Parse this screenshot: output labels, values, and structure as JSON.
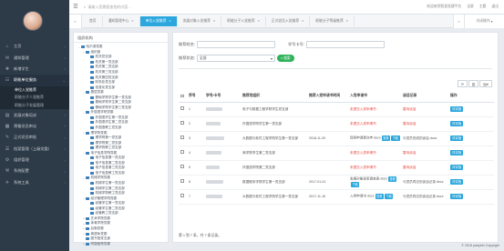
{
  "sidebar": {
    "user": {
      "name": "",
      "role": ""
    },
    "items": [
      {
        "label": "主页",
        "icon": "⌂",
        "arrow": "›"
      },
      {
        "label": "通知管理",
        "icon": "✉",
        "arrow": "›"
      },
      {
        "label": "新增学生",
        "icon": "✚",
        "arrow": "›"
      }
    ],
    "open_item": {
      "label": "职能单位服务",
      "icon": "☷",
      "arrow": "⌄"
    },
    "sub_items": [
      "单位入党推荐",
      "职能分子人党推荐",
      "职能分子发展管理"
    ],
    "more_items": [
      {
        "label": "发展对象培训",
        "icon": "▤",
        "arrow": "›"
      },
      {
        "label": "预备党员审议",
        "icon": "▦",
        "arrow": "›"
      },
      {
        "label": "正式党员审批",
        "icon": "✎",
        "arrow": "›"
      },
      {
        "label": "档案管理（上级党委）",
        "icon": "☰",
        "arrow": "›"
      },
      {
        "label": "组织管理",
        "icon": "⚙",
        "arrow": "›"
      },
      {
        "label": "系统配置",
        "icon": "⚒",
        "arrow": "›"
      },
      {
        "label": "系统工具",
        "icon": "✈",
        "arrow": "›"
      }
    ]
  },
  "topbar": {
    "search_placeholder": "请输入您需要查找的内容...",
    "links": [
      "欢迎来到智慧党建平台",
      "全屏",
      "主题",
      "退出"
    ],
    "menu_icon": "☰"
  },
  "tabs": {
    "items": [
      "首页",
      "通知管理中心",
      "单位入党推荐",
      "发展对象入党推荐",
      "职能分子入党推荐",
      "正式党员入党推荐",
      "职能分子等级推荐"
    ],
    "active_index": 2,
    "close_label": "关闭操作",
    "left_arrow": "«",
    "right_arrow": "»"
  },
  "left_panel": {
    "title": "组织机构",
    "tree": [
      {
        "label": "哈尔滨党委",
        "level": 0,
        "toggle": "−"
      },
      {
        "label": "组织部",
        "level": 1,
        "toggle": "−"
      },
      {
        "label": "机关党支部",
        "level": 2,
        "toggle": ""
      },
      {
        "label": "机关第一党支部",
        "level": 2,
        "toggle": ""
      },
      {
        "label": "机关第二党支部",
        "level": 2,
        "toggle": ""
      },
      {
        "label": "机关第三党支部",
        "level": 2,
        "toggle": ""
      },
      {
        "label": "机关第四党支部",
        "level": 2,
        "toggle": ""
      },
      {
        "label": "财务处党支部",
        "level": 2,
        "toggle": ""
      },
      {
        "label": "信息化党支部",
        "level": 2,
        "toggle": ""
      },
      {
        "label": "基层党委",
        "level": 1,
        "toggle": "−"
      },
      {
        "label": "基础学院学生第一党支部",
        "level": 2,
        "toggle": ""
      },
      {
        "label": "基础学院学生第二党支部",
        "level": 2,
        "toggle": ""
      },
      {
        "label": "基础学院学生第三党支部",
        "level": 2,
        "toggle": ""
      },
      {
        "label": "外国语学院党委",
        "level": 1,
        "toggle": "−"
      },
      {
        "label": "外国语学生第一党支部",
        "level": 2,
        "toggle": ""
      },
      {
        "label": "外国语学生第二党支部",
        "level": 2,
        "toggle": ""
      },
      {
        "label": "外国语教工党支部",
        "level": 2,
        "toggle": ""
      },
      {
        "label": "理学院党委",
        "level": 1,
        "toggle": "−"
      },
      {
        "label": "理学院第一党支部",
        "level": 2,
        "toggle": ""
      },
      {
        "label": "理学院第二党支部",
        "level": 2,
        "toggle": ""
      },
      {
        "label": "理学院教工党支部",
        "level": 2,
        "toggle": ""
      },
      {
        "label": "电子信息学院党委",
        "level": 1,
        "toggle": "−"
      },
      {
        "label": "电子信息第一党支部",
        "level": 2,
        "toggle": ""
      },
      {
        "label": "电子信息第二党支部",
        "level": 2,
        "toggle": ""
      },
      {
        "label": "电子信息第三党支部",
        "level": 2,
        "toggle": ""
      },
      {
        "label": "电子信息教工党支部",
        "level": 2,
        "toggle": ""
      },
      {
        "label": "机械学院党委",
        "level": 1,
        "toggle": "−"
      },
      {
        "label": "机械学生第一党支部",
        "level": 2,
        "toggle": ""
      },
      {
        "label": "机械学生第二党支部",
        "level": 2,
        "toggle": ""
      },
      {
        "label": "机械学院教工党支部",
        "level": 2,
        "toggle": ""
      },
      {
        "label": "经济管理学院党委",
        "level": 1,
        "toggle": "−"
      },
      {
        "label": "经管学生第一党支部",
        "level": 2,
        "toggle": ""
      },
      {
        "label": "经管学生第二党支部",
        "level": 2,
        "toggle": ""
      },
      {
        "label": "经管教工党支部",
        "level": 2,
        "toggle": ""
      },
      {
        "label": "艺术学院党委",
        "level": 1,
        "toggle": "+"
      },
      {
        "label": "体育学院党委",
        "level": 1,
        "toggle": "+"
      },
      {
        "label": "后勤党委",
        "level": 1,
        "toggle": "+"
      },
      {
        "label": "离退休党委",
        "level": 1,
        "toggle": "+"
      },
      {
        "label": "图书馆党支部",
        "level": 1,
        "toggle": ""
      },
      {
        "label": "附属医院党委",
        "level": 1,
        "toggle": "+"
      }
    ]
  },
  "form": {
    "name_label": "推荐姓名:",
    "card_label": "学号卡号:",
    "status_label": "推荐状态:",
    "status_value": "全部",
    "search_btn": "搜索"
  },
  "table": {
    "headers": [
      "序号",
      "学号/卡号",
      "推荐党组织",
      "推荐入党申请书时间",
      "入党申请书",
      "谈话记录",
      "操作"
    ],
    "rows": [
      {
        "no": "1",
        "org": "电子与数据工程学院学生党支部",
        "time": "",
        "app": "未提交入党申请书",
        "talk": "暂待谈话",
        "action": "详评指"
      },
      {
        "no": "2",
        "org": "外国语学院学生第一党支部",
        "time": "",
        "app": "未提交入党申请书",
        "talk": "暂待谈话",
        "action": "详评指"
      },
      {
        "no": "3",
        "org": "大数据与软件工程学院学生第一党支部",
        "time": "2018-11-20",
        "app": "现将申请提交申 docx",
        "talk": "与党员完成的谈话 docx",
        "action": "详评指",
        "view": "查看",
        "down": "下载"
      },
      {
        "no": "4",
        "org": "商学院学生第二党支部",
        "time": "",
        "app": "未提交入党申请书",
        "talk": "暂待谈话",
        "action": "详评指"
      },
      {
        "no": "5",
        "org": "外国语学院第二党支部",
        "time": "",
        "app": "未提交入党申请书",
        "talk": "暂待谈话",
        "action": "详评指"
      },
      {
        "no": "6",
        "org": "数据服务学院学生第一党支部",
        "time": "2017-01-01",
        "app": "发展对象政审调查表 docx",
        "talk": "与党员同志的谈话记录 docx",
        "action": "详评指",
        "view": "查看",
        "down": "下载"
      },
      {
        "no": "7",
        "org": "大数据与软件工程学院学生第一党支部",
        "time": "2017-11-16",
        "app": "入党申请书 docx",
        "talk": "与党员同志的谈话记录 docx",
        "action": "详评指",
        "view": "查看",
        "down": "下载"
      }
    ]
  },
  "pagination": "第 1 到 7 条，共 7 条记录。",
  "copyright": "© 2018 partybin Copyright",
  "colors": {
    "accent": "#2ba7dd",
    "sidebar": "#2d3a47",
    "danger": "#e8423a",
    "success": "#2fb35a"
  }
}
